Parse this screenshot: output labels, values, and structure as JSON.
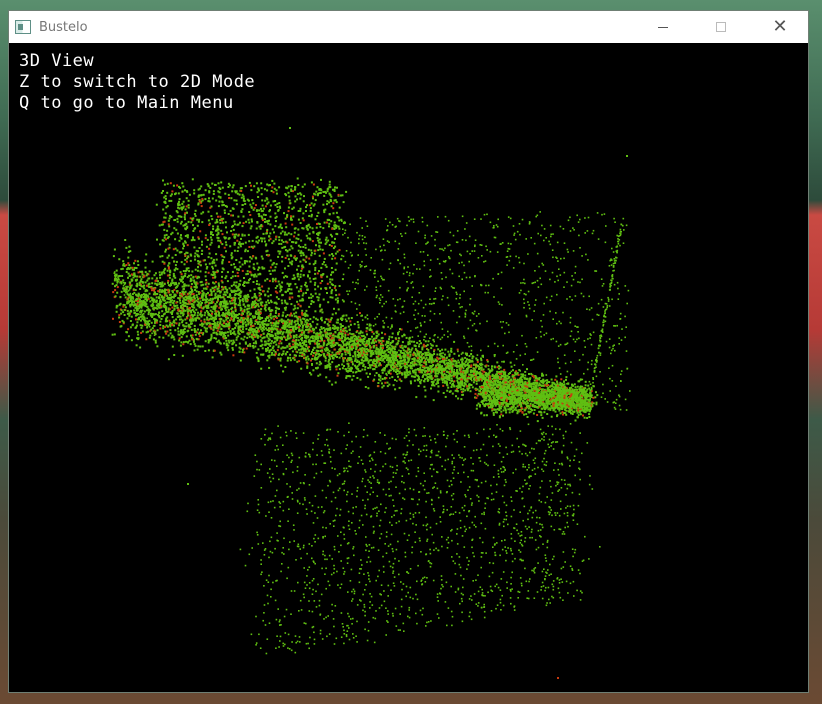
{
  "window": {
    "title": "Bustelo",
    "icon": "app-window-icon"
  },
  "controls": {
    "minimize_icon": "minimize-icon",
    "maximize_icon": "maximize-icon",
    "close_icon": "close-icon",
    "close_glyph": "✕"
  },
  "hud": {
    "line1": "3D View",
    "line2": "Z to switch to 2D Mode",
    "line3": "Q to go to Main Menu"
  },
  "scene": {
    "background": "#000000",
    "point_color_primary": "#5fbf12",
    "point_color_accent": "#c83a10"
  }
}
